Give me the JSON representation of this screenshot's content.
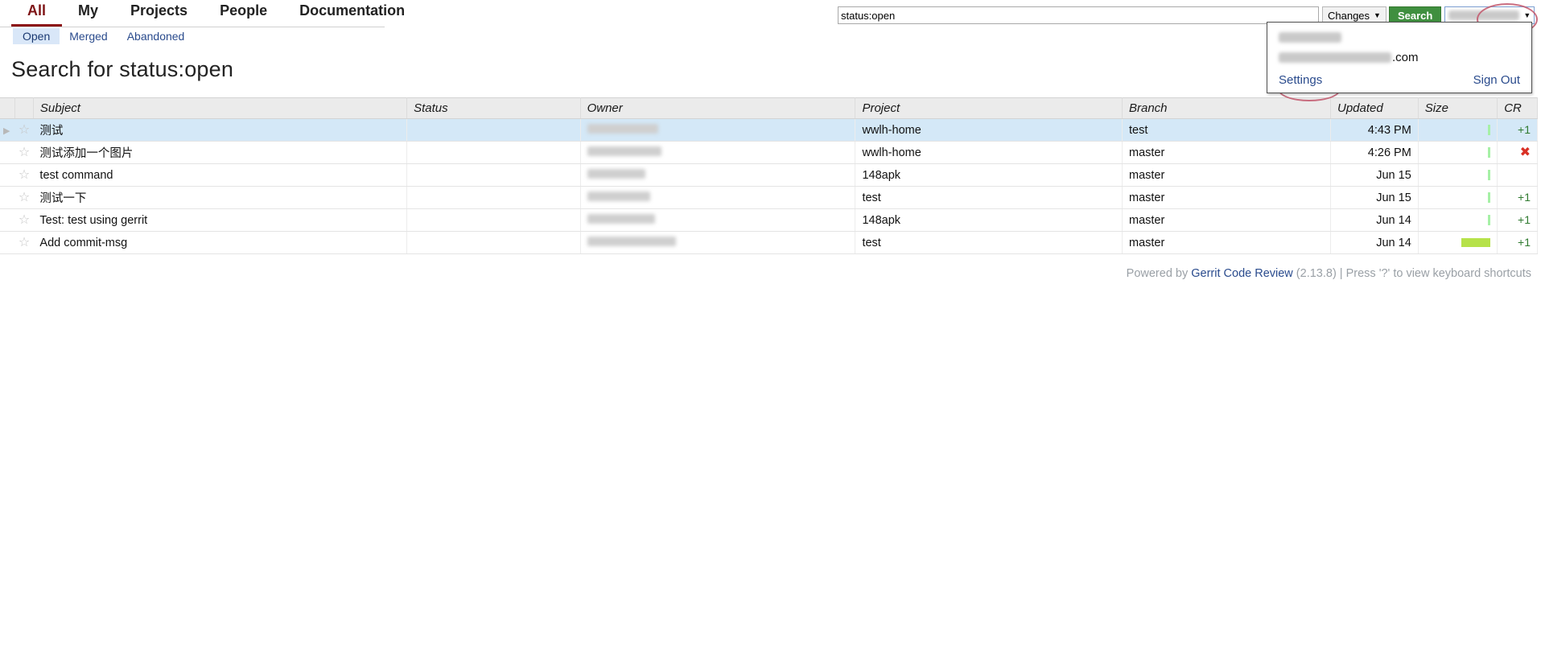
{
  "header": {
    "main_tabs": [
      {
        "label": "All",
        "active": true
      },
      {
        "label": "My",
        "active": false
      },
      {
        "label": "Projects",
        "active": false
      },
      {
        "label": "People",
        "active": false
      },
      {
        "label": "Documentation",
        "active": false
      }
    ],
    "sub_tabs": [
      {
        "label": "Open",
        "active": true
      },
      {
        "label": "Merged",
        "active": false
      },
      {
        "label": "Abandoned",
        "active": false
      }
    ],
    "search": {
      "value": "status:open",
      "placeholder": "",
      "scope_label": "Changes",
      "scope_caret": "▼",
      "search_button_label": "Search"
    },
    "account": {
      "button_name_redacted": true,
      "button_caret": "▼",
      "panel": {
        "name_redacted": true,
        "email_suffix": ".com",
        "settings_label": "Settings",
        "sign_out_label": "Sign Out"
      }
    }
  },
  "page": {
    "title": "Search for status:open"
  },
  "table": {
    "columns": [
      {
        "key": "subject",
        "label": "Subject"
      },
      {
        "key": "status",
        "label": "Status"
      },
      {
        "key": "owner",
        "label": "Owner"
      },
      {
        "key": "project",
        "label": "Project"
      },
      {
        "key": "branch",
        "label": "Branch"
      },
      {
        "key": "updated",
        "label": "Updated"
      },
      {
        "key": "size",
        "label": "Size"
      },
      {
        "key": "cr",
        "label": "CR"
      }
    ],
    "rows": [
      {
        "expand_arrow": "▶",
        "star": "☆",
        "subject": "测试",
        "status": "",
        "owner_redacted": true,
        "project": "wwlh-home",
        "branch": "test",
        "updated": "4:43 PM",
        "size_bar": "small",
        "cr": "+1",
        "cr_kind": "plus",
        "selected": true
      },
      {
        "expand_arrow": "",
        "star": "☆",
        "subject": "测试添加一个图片",
        "status": "",
        "owner_redacted": true,
        "project": "wwlh-home",
        "branch": "master",
        "updated": "4:26 PM",
        "size_bar": "small",
        "cr": "✖",
        "cr_kind": "x",
        "selected": false
      },
      {
        "expand_arrow": "",
        "star": "☆",
        "subject": "test command",
        "status": "",
        "owner_redacted": true,
        "project": "148apk",
        "branch": "master",
        "updated": "Jun 15",
        "size_bar": "small",
        "cr": "",
        "cr_kind": "none",
        "selected": false
      },
      {
        "expand_arrow": "",
        "star": "☆",
        "subject": "测试一下",
        "status": "",
        "owner_redacted": true,
        "project": "test",
        "branch": "master",
        "updated": "Jun 15",
        "size_bar": "small",
        "cr": "+1",
        "cr_kind": "plus",
        "selected": false
      },
      {
        "expand_arrow": "",
        "star": "☆",
        "subject": "Test: test using gerrit",
        "status": "",
        "owner_redacted": true,
        "project": "148apk",
        "branch": "master",
        "updated": "Jun 14",
        "size_bar": "small",
        "cr": "+1",
        "cr_kind": "plus",
        "selected": false
      },
      {
        "expand_arrow": "",
        "star": "☆",
        "subject": "Add commit-msg",
        "status": "",
        "owner_redacted": true,
        "project": "test",
        "branch": "master",
        "updated": "Jun 14",
        "size_bar": "big",
        "cr": "+1",
        "cr_kind": "plus",
        "selected": false
      }
    ]
  },
  "footer": {
    "powered_by": "Powered by ",
    "product": "Gerrit Code Review",
    "version": " (2.13.8) | Press '?' to view keyboard shortcuts"
  },
  "colors": {
    "accent_red": "#8b1316",
    "link_blue": "#2a4b8d",
    "search_green": "#3f8f3f",
    "selected_row": "#d4e8f7",
    "active_subtab": "#d9e7f8",
    "size_bar_green": "#a6f0a6",
    "size_bar_big": "#b6e24a",
    "cr_plus_green": "#2f7a2f",
    "cr_x_red": "#d93025",
    "annotation_red": "#c2566b"
  }
}
